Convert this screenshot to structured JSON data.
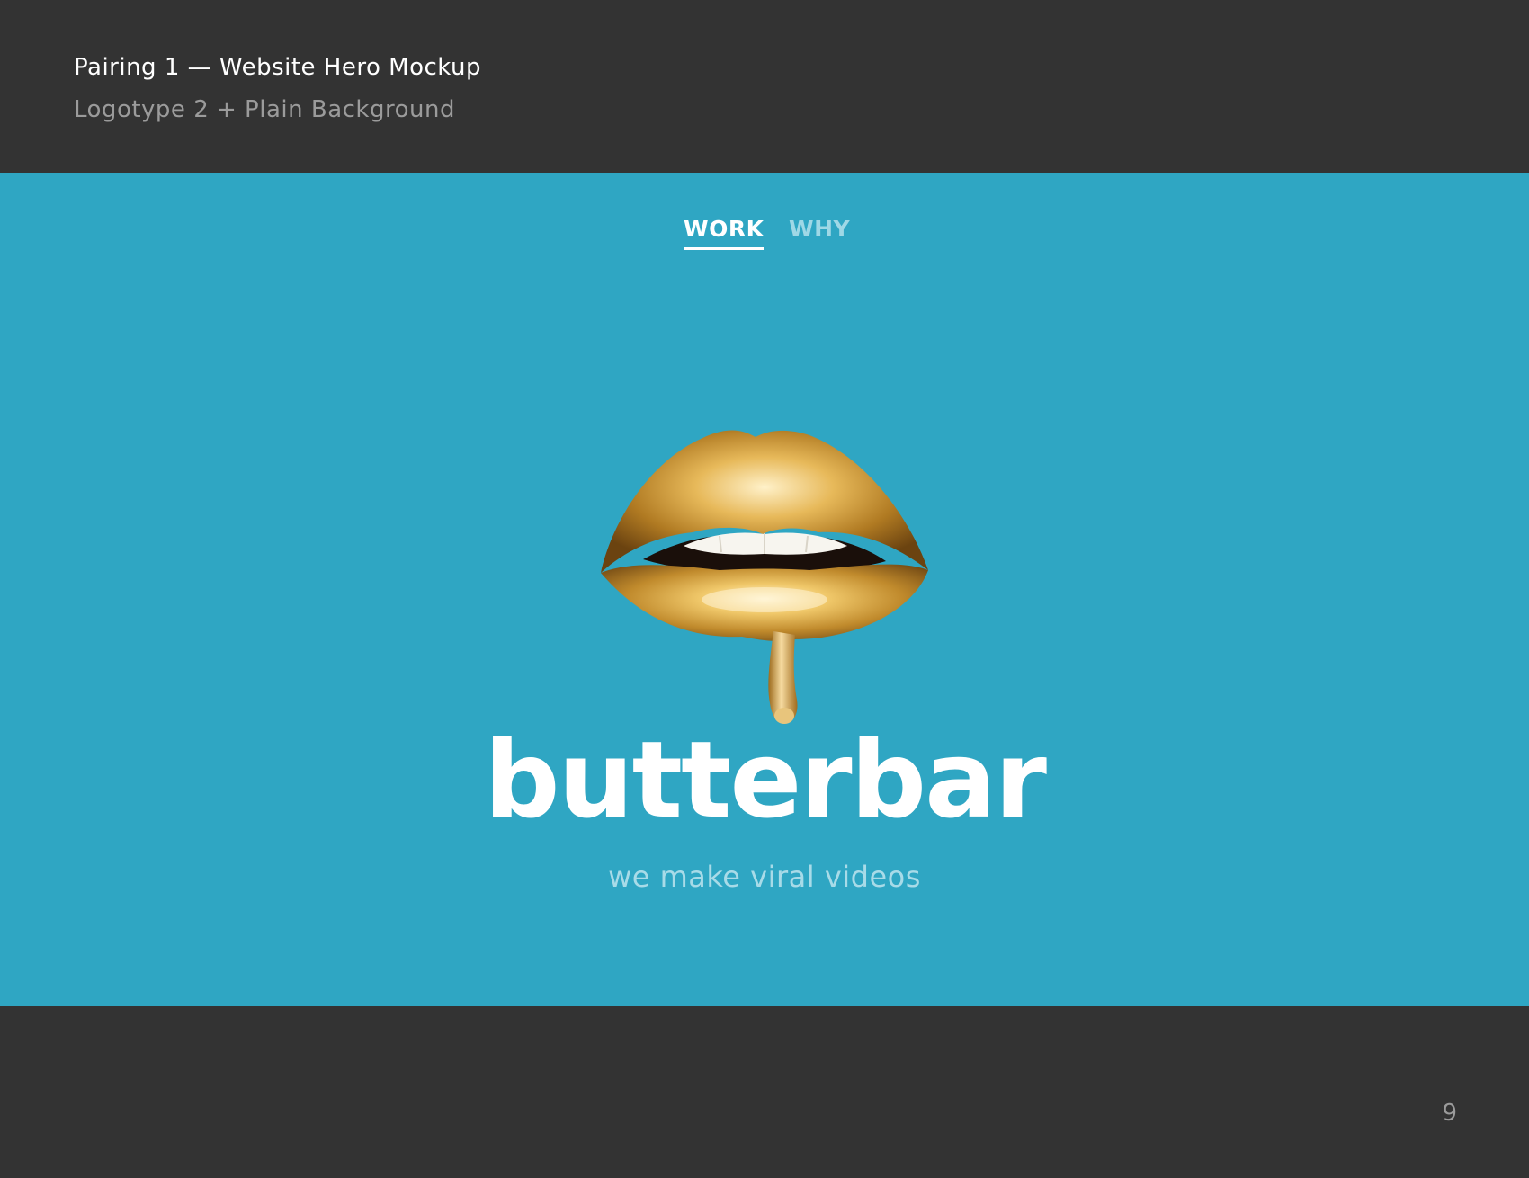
{
  "slide": {
    "title": "Pairing 1 — Website Hero Mockup",
    "subtitle": "Logotype 2 + Plain Background",
    "page_number": "9"
  },
  "hero": {
    "background_color": "#2fa6c3",
    "nav": {
      "items": [
        {
          "label": "WORK",
          "active": true
        },
        {
          "label": "WHY",
          "active": false
        }
      ]
    },
    "image": {
      "icon": "gold-dripping-lips-icon"
    },
    "logotype": "butterbar",
    "tagline": "we make viral videos"
  },
  "colors": {
    "frame": "#333333",
    "hero_bg": "#2fa6c3",
    "nav_inactive": "#9fd8e6",
    "tagline": "#a8dbe8",
    "gold": "#c8962e"
  }
}
